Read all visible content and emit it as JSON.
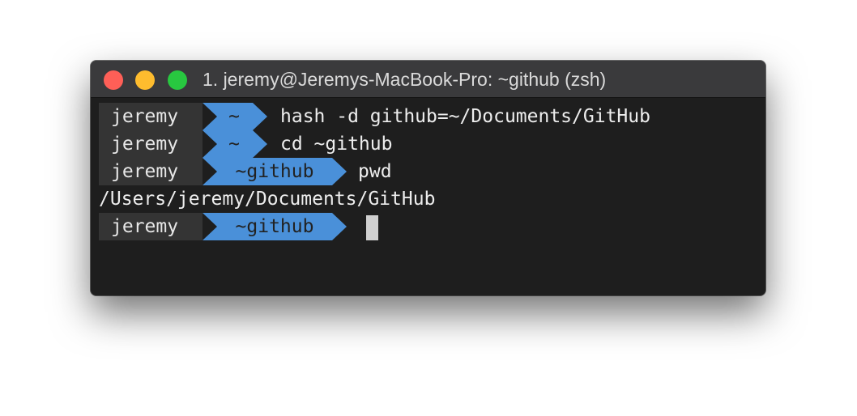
{
  "window": {
    "title": "1. jeremy@Jeremys-MacBook-Pro: ~github (zsh)"
  },
  "terminal": {
    "lines": [
      {
        "user": "jeremy",
        "dir": "~",
        "command": "hash -d github=~/Documents/GitHub"
      },
      {
        "user": "jeremy",
        "dir": "~",
        "command": "cd ~github"
      },
      {
        "user": "jeremy",
        "dir": "~github",
        "command": "pwd"
      }
    ],
    "output": "/Users/jeremy/Documents/GitHub",
    "prompt": {
      "user": "jeremy",
      "dir": "~github",
      "command": ""
    }
  },
  "colors": {
    "prompt_dir_bg": "#4a90d9",
    "prompt_user_bg": "#343434",
    "terminal_bg": "#1e1e1e"
  }
}
